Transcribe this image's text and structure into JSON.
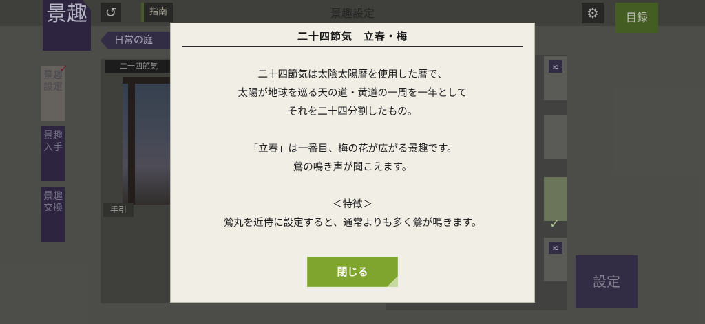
{
  "header": {
    "logo_text": "景趣",
    "back_icon": "↺",
    "guide_label": "指南",
    "title": "景趣設定",
    "gear_icon": "⚙",
    "catalog_label": "目録"
  },
  "filter": {
    "selected": "日常の庭"
  },
  "side_tabs": [
    {
      "label": "景趣設定",
      "active": true
    },
    {
      "label": "景趣入手",
      "active": false
    },
    {
      "label": "景趣交換",
      "active": false
    }
  ],
  "preview": {
    "label": "二十四節気",
    "tebiki_label": "手引"
  },
  "list": {
    "icon_glyph": "≋",
    "check_glyph": "✓"
  },
  "set_button_label": "設定",
  "modal": {
    "title": "二十四節気　立春・梅",
    "paragraph1": [
      "二十四節気は太陰太陽暦を使用した暦で、",
      "太陽が地球を巡る天の道・黄道の一周を一年として",
      "それを二十四分割したもの。"
    ],
    "paragraph2": [
      "「立春」は一番目、梅の花が広がる景趣です。",
      "鶯の鳴き声が聞こえます。"
    ],
    "feature_heading": "＜特徴＞",
    "feature_text": "鶯丸を近侍に設定すると、通常よりも多く鶯が鳴きます。",
    "close_label": "閉じる"
  },
  "colors": {
    "accent_green": "#7fa52e",
    "purple": "#352c4a",
    "modal_bg": "#f1eee6"
  }
}
